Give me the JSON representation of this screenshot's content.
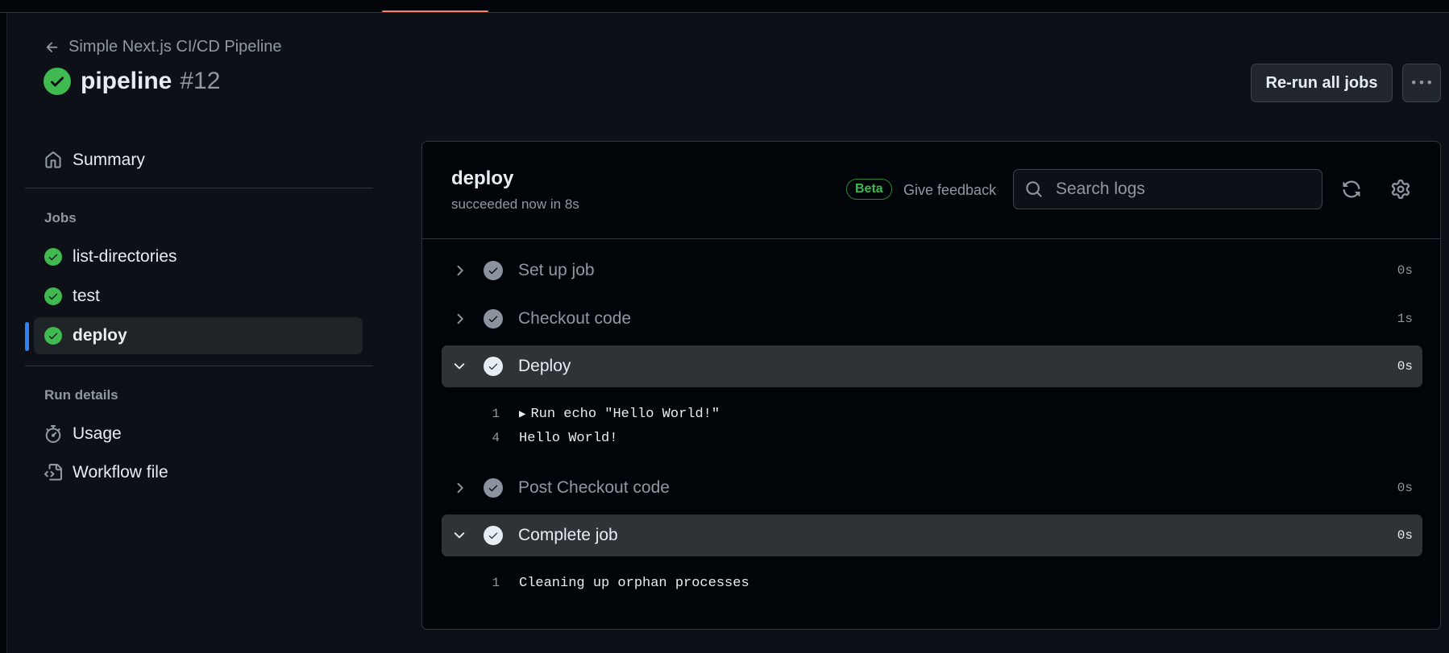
{
  "header": {
    "back_label": "Simple Next.js CI/CD Pipeline",
    "workflow_name": "pipeline",
    "run_number": "#12",
    "rerun_label": "Re-run all jobs",
    "more_label": "···"
  },
  "sidebar": {
    "summary_label": "Summary",
    "jobs_heading": "Jobs",
    "jobs": [
      {
        "label": "list-directories",
        "status": "success"
      },
      {
        "label": "test",
        "status": "success"
      },
      {
        "label": "deploy",
        "status": "success",
        "selected": true
      }
    ],
    "run_details_heading": "Run details",
    "usage_label": "Usage",
    "workflow_file_label": "Workflow file"
  },
  "job": {
    "name": "deploy",
    "status_text": "succeeded now in 8s",
    "beta_badge": "Beta",
    "feedback_label": "Give feedback",
    "search_placeholder": "Search logs"
  },
  "steps": [
    {
      "name": "Set up job",
      "duration": "0s",
      "expanded": false
    },
    {
      "name": "Checkout code",
      "duration": "1s",
      "expanded": false
    },
    {
      "name": "Deploy",
      "duration": "0s",
      "expanded": true,
      "log": [
        {
          "line": "1",
          "text": "Run echo \"Hello World!\"",
          "collapsible": true
        },
        {
          "line": "4",
          "text": "Hello World!"
        }
      ]
    },
    {
      "name": "Post Checkout code",
      "duration": "0s",
      "expanded": false
    },
    {
      "name": "Complete job",
      "duration": "0s",
      "expanded": true,
      "log": [
        {
          "line": "1",
          "text": "Cleaning up orphan processes"
        }
      ]
    }
  ],
  "colors": {
    "success": "#3fb950",
    "accent": "#2f81f7",
    "tab_underline": "#f78166",
    "background": "#0d1117"
  }
}
